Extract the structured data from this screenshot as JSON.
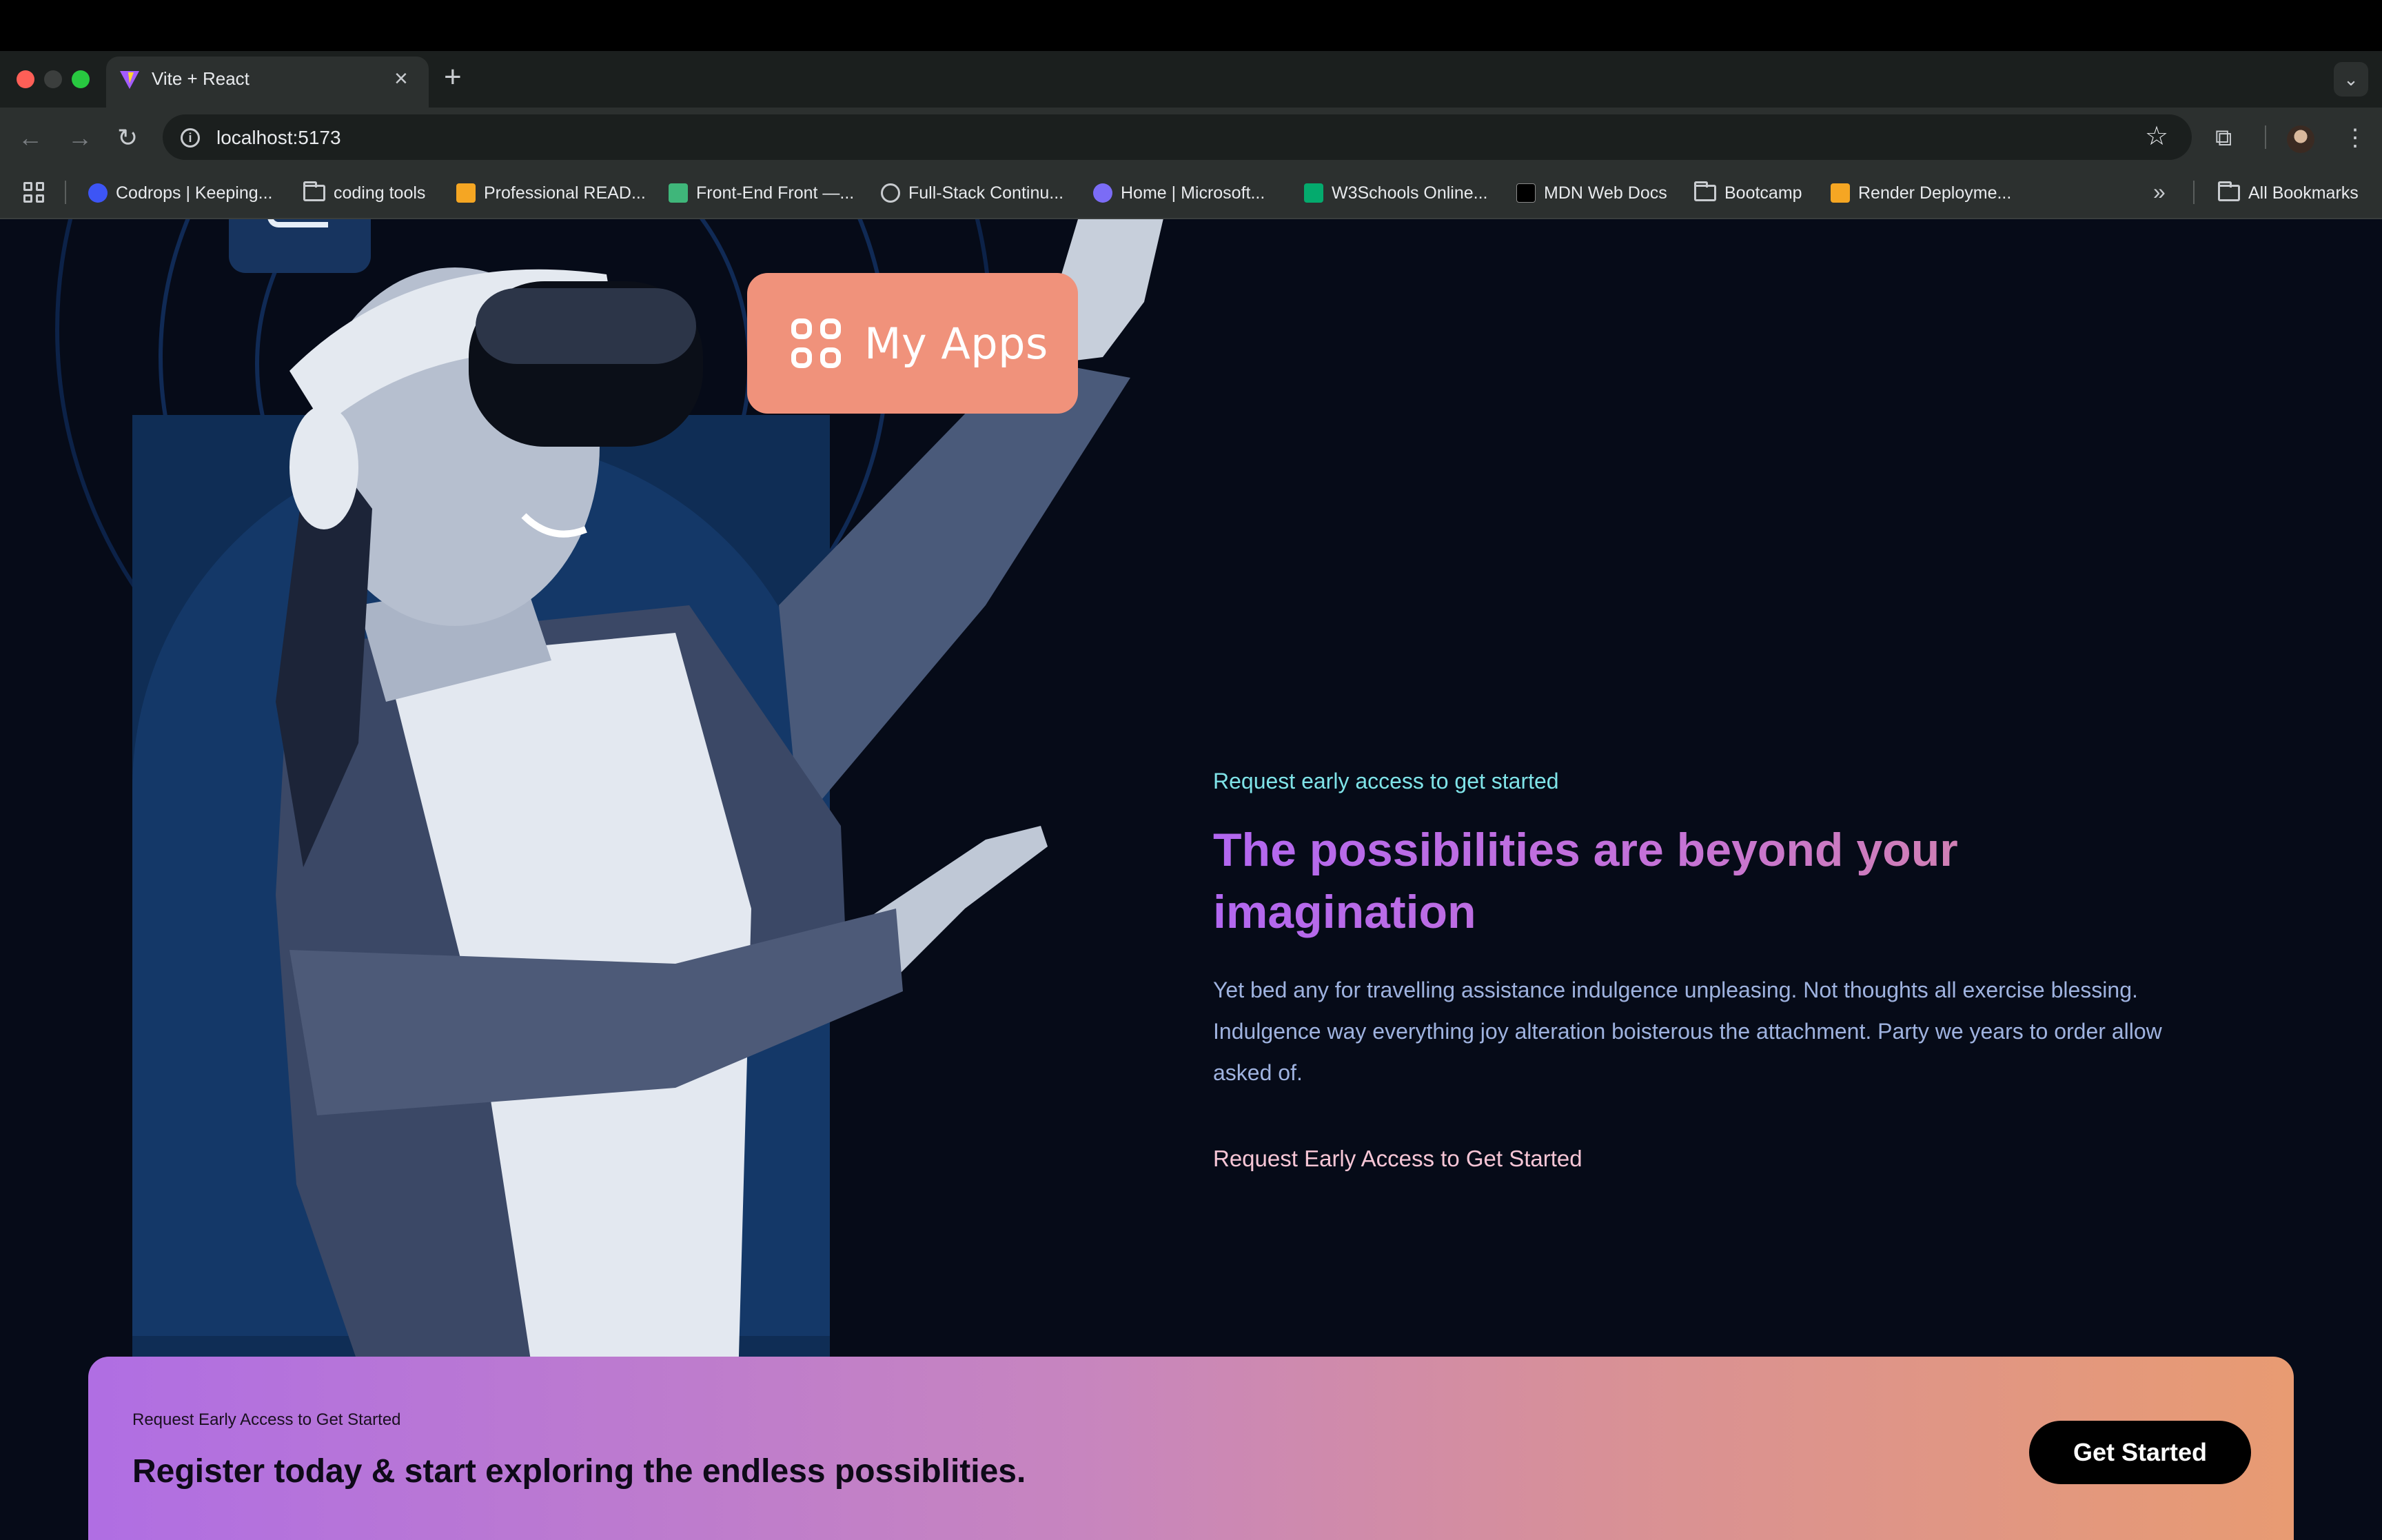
{
  "browser": {
    "tab_title": "Vite + React",
    "tab_close": "×",
    "new_tab": "+",
    "url": "localhost:5173",
    "bookmarks": [
      {
        "label": "Codrops | Keeping...",
        "icon": "codrops-icon",
        "color": "#3d55f5"
      },
      {
        "label": "coding tools",
        "icon": "folder-icon"
      },
      {
        "label": "Professional READ...",
        "icon": "fs-icon",
        "color": "#f5a623"
      },
      {
        "label": "Front-End Front —...",
        "icon": "frontend-icon",
        "color": "#3fb67a"
      },
      {
        "label": "Full-Stack Continu...",
        "icon": "globe-icon",
        "color": "#c8cbcf"
      },
      {
        "label": "Home | Microsoft...",
        "icon": "microsoft-learn-icon",
        "color": "#7b6cf6"
      },
      {
        "label": "W3Schools Online...",
        "icon": "w3schools-icon",
        "color": "#04aa6d"
      },
      {
        "label": "MDN Web Docs",
        "icon": "mdn-icon",
        "color": "#000000"
      },
      {
        "label": "Bootcamp",
        "icon": "folder-icon"
      },
      {
        "label": "Render Deployme...",
        "icon": "fs-icon",
        "color": "#f5a623"
      }
    ],
    "all_bookmarks": "All Bookmarks"
  },
  "hero": {
    "my_apps_label": "My Apps",
    "eyebrow": "Request early access to get started",
    "headline": "The possibilities are beyond your imagination",
    "body": "Yet bed any for travelling assistance indulgence unpleasing. Not thoughts all exercise blessing. Indulgence way everything joy alteration boisterous the attachment. Party we years to order allow asked of.",
    "cta": "Request Early Access to Get Started"
  },
  "banner": {
    "eyebrow": "Request Early Access to Get Started",
    "title": "Register today & start exploring the endless possiblities.",
    "button": "Get Started"
  },
  "colors": {
    "page_bg": "#060b18",
    "accent_peach": "#f0927b",
    "eyebrow_cyan": "#7fe3e8",
    "headline_purple": "#b267f0"
  }
}
